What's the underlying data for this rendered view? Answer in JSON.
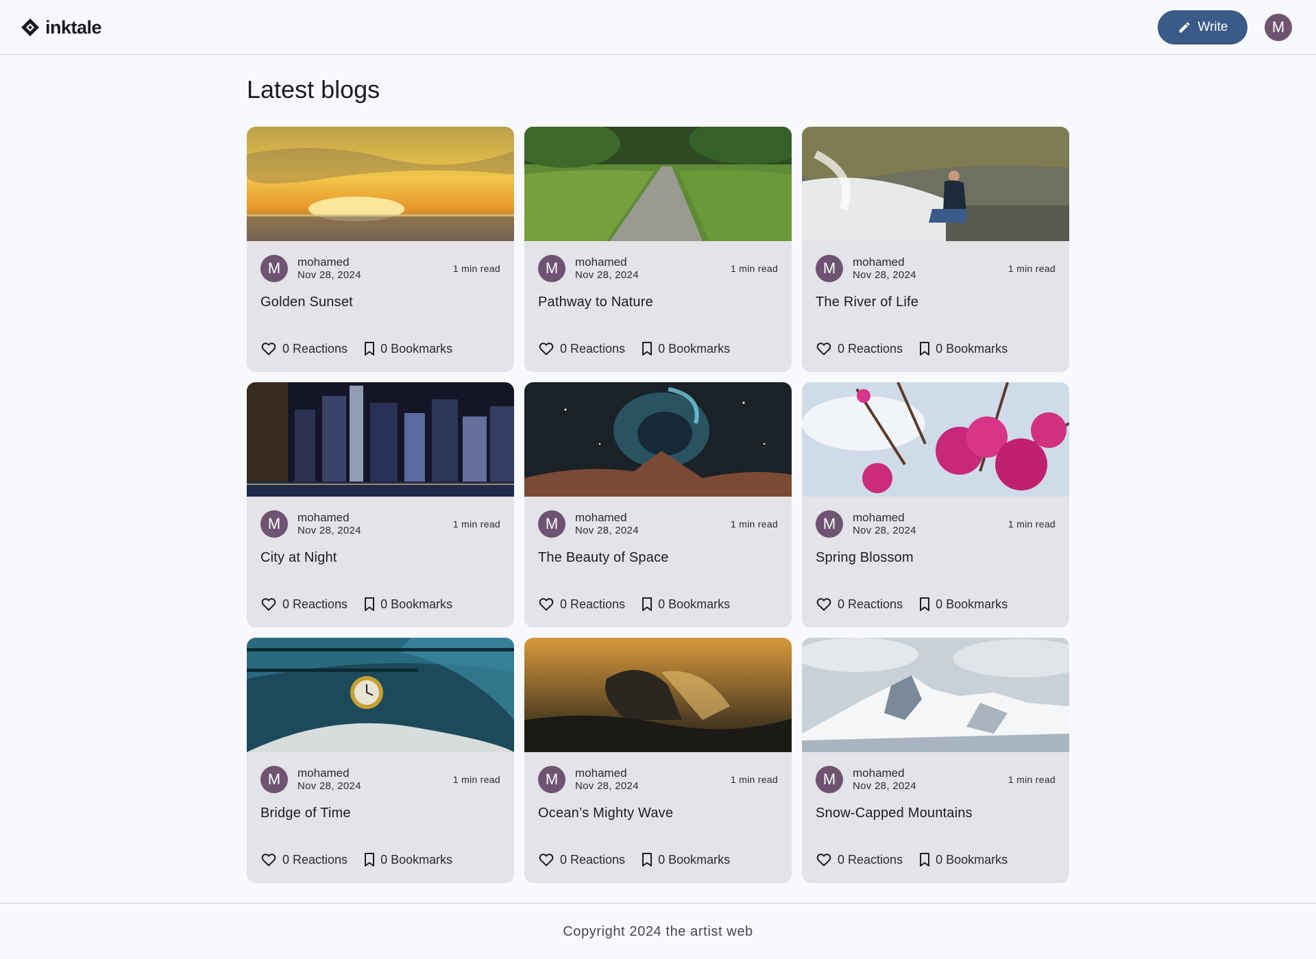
{
  "header": {
    "logo_text": "inktale",
    "write_label": "Write",
    "user_initial": "M"
  },
  "main": {
    "title": "Latest blogs",
    "posts": [
      {
        "title": "Golden Sunset",
        "author": "mohamed",
        "initial": "M",
        "date": "Nov 28, 2024",
        "read_time": "1 min read",
        "reactions": "0 Reactions",
        "bookmarks": "0 Bookmarks",
        "image": "sunset-over-sea"
      },
      {
        "title": "Pathway to Nature",
        "author": "mohamed",
        "initial": "M",
        "date": "Nov 28, 2024",
        "read_time": "1 min read",
        "reactions": "0 Reactions",
        "bookmarks": "0 Bookmarks",
        "image": "boardwalk-in-grass"
      },
      {
        "title": "The River of Life",
        "author": "mohamed",
        "initial": "M",
        "date": "Nov 28, 2024",
        "read_time": "1 min read",
        "reactions": "0 Reactions",
        "bookmarks": "0 Bookmarks",
        "image": "man-by-river"
      },
      {
        "title": "City at Night",
        "author": "mohamed",
        "initial": "M",
        "date": "Nov 28, 2024",
        "read_time": "1 min read",
        "reactions": "0 Reactions",
        "bookmarks": "0 Bookmarks",
        "image": "city-skyline-night"
      },
      {
        "title": "The Beauty of Space",
        "author": "mohamed",
        "initial": "M",
        "date": "Nov 28, 2024",
        "read_time": "1 min read",
        "reactions": "0 Reactions",
        "bookmarks": "0 Bookmarks",
        "image": "space-nebula"
      },
      {
        "title": "Spring Blossom",
        "author": "mohamed",
        "initial": "M",
        "date": "Nov 28, 2024",
        "read_time": "1 min read",
        "reactions": "0 Reactions",
        "bookmarks": "0 Bookmarks",
        "image": "pink-blossom-branches"
      },
      {
        "title": "Bridge of Time",
        "author": "mohamed",
        "initial": "M",
        "date": "Nov 28, 2024",
        "read_time": "1 min read",
        "reactions": "0 Reactions",
        "bookmarks": "0 Bookmarks",
        "image": "bridge-clock"
      },
      {
        "title": "Ocean’s Mighty Wave",
        "author": "mohamed",
        "initial": "M",
        "date": "Nov 28, 2024",
        "read_time": "1 min read",
        "reactions": "0 Reactions",
        "bookmarks": "0 Bookmarks",
        "image": "whale-breach"
      },
      {
        "title": "Snow-Capped Mountains",
        "author": "mohamed",
        "initial": "M",
        "date": "Nov 28, 2024",
        "read_time": "1 min read",
        "reactions": "0 Reactions",
        "bookmarks": "0 Bookmarks",
        "image": "snowy-mountain"
      }
    ]
  },
  "footer": {
    "copyright": "Copyright 2024 the artist web"
  },
  "colors": {
    "accent": "#3a5a88",
    "avatar": "#6e5470",
    "card_bg": "#e3e3e8",
    "page_bg": "#f8f9fc"
  },
  "icons": [
    "inktale-logo-icon",
    "pencil-icon",
    "heart-icon",
    "bookmark-icon"
  ]
}
